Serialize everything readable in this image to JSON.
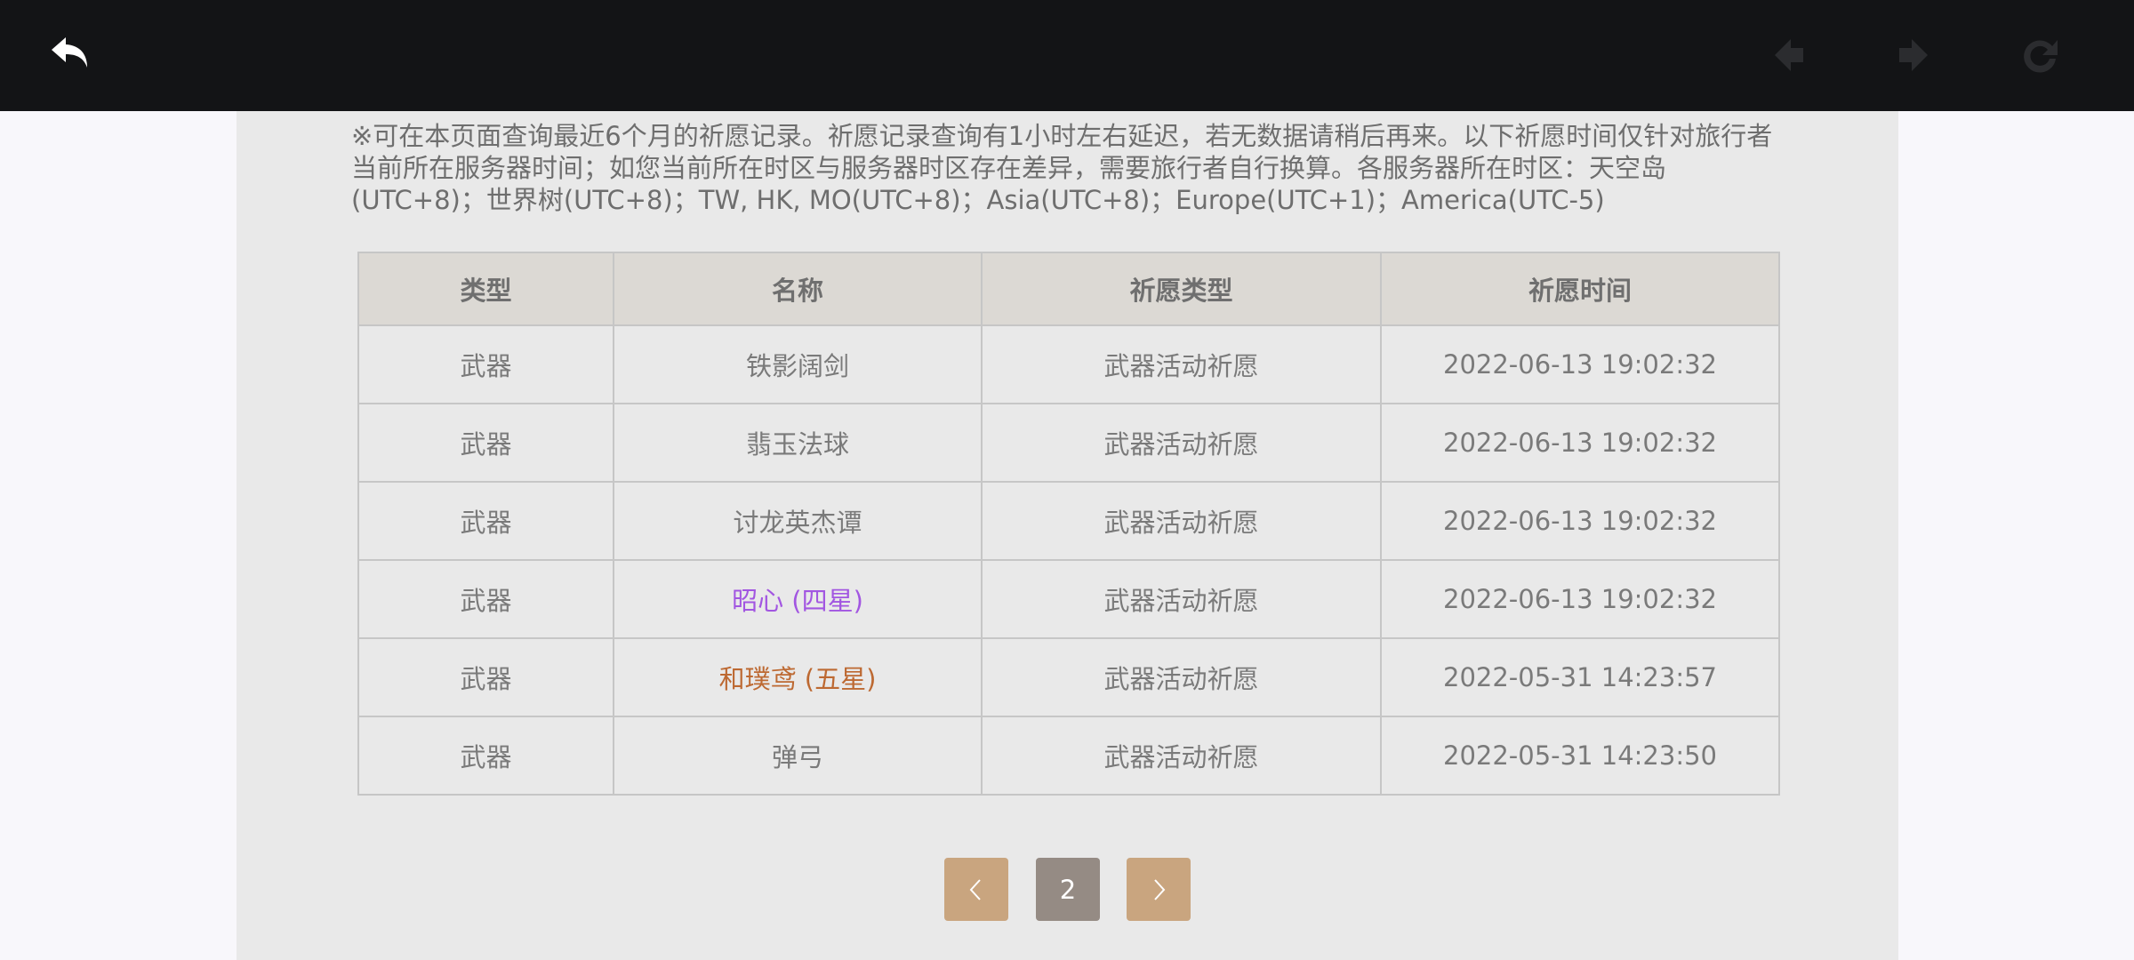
{
  "toolbar": {
    "back_icon": "back-arrow-icon",
    "prev_icon": "nav-back-icon",
    "next_icon": "nav-forward-icon",
    "refresh_icon": "refresh-icon"
  },
  "notice": "※可在本页面查询最近6个月的祈愿记录。祈愿记录查询有1小时左右延迟，若无数据请稍后再来。以下祈愿时间仅针对旅行者当前所在服务器时间；如您当前所在时区与服务器时区存在差异，需要旅行者自行换算。各服务器所在时区：天空岛(UTC+8)；世界树(UTC+8)；TW, HK, MO(UTC+8)；Asia(UTC+8)；Europe(UTC+1)；America(UTC-5)",
  "table": {
    "headers": [
      "类型",
      "名称",
      "祈愿类型",
      "祈愿时间"
    ],
    "rows": [
      {
        "type": "武器",
        "name": "铁影阔剑",
        "wish_type": "武器活动祈愿",
        "time": "2022-06-13 19:02:32",
        "rarity_color": "#7a7a7a"
      },
      {
        "type": "武器",
        "name": "翡玉法球",
        "wish_type": "武器活动祈愿",
        "time": "2022-06-13 19:02:32",
        "rarity_color": "#7a7a7a"
      },
      {
        "type": "武器",
        "name": "讨龙英杰谭",
        "wish_type": "武器活动祈愿",
        "time": "2022-06-13 19:02:32",
        "rarity_color": "#7a7a7a"
      },
      {
        "type": "武器",
        "name": "昭心 (四星)",
        "wish_type": "武器活动祈愿",
        "time": "2022-06-13 19:02:32",
        "rarity_color": "#a256e1"
      },
      {
        "type": "武器",
        "name": "和璞鸢 (五星)",
        "wish_type": "武器活动祈愿",
        "time": "2022-05-31 14:23:57",
        "rarity_color": "#bd6932"
      },
      {
        "type": "武器",
        "name": "弹弓",
        "wish_type": "武器活动祈愿",
        "time": "2022-05-31 14:23:50",
        "rarity_color": "#7a7a7a"
      }
    ]
  },
  "pagination": {
    "current_page": "2",
    "prev_icon": "chevron-left-icon",
    "next_icon": "chevron-right-icon"
  }
}
